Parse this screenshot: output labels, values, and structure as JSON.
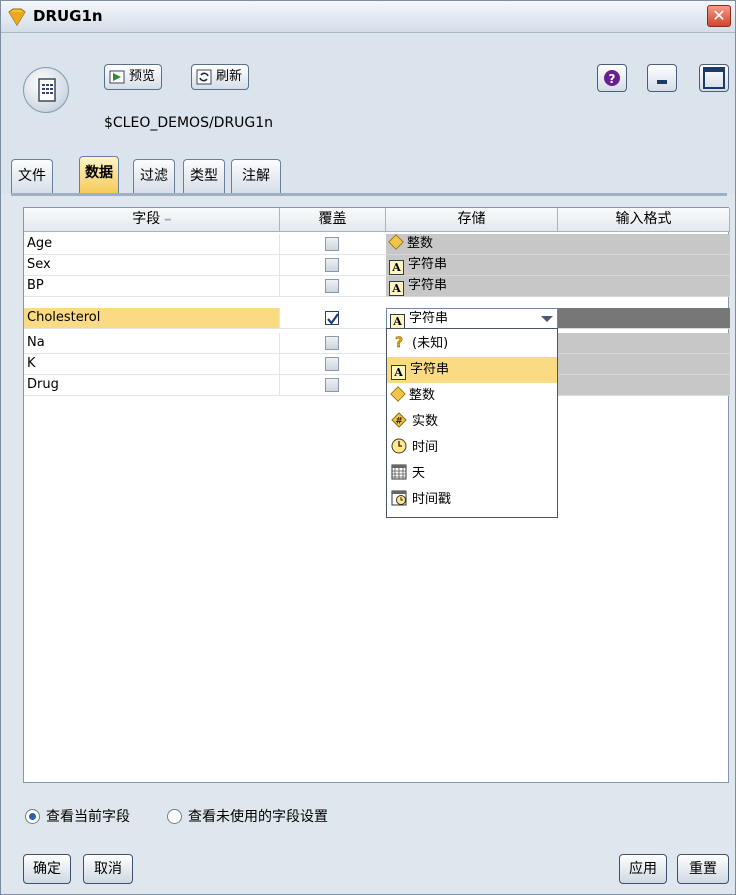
{
  "window": {
    "title": "DRUG1n",
    "close_glyph": "✕"
  },
  "toolbar": {
    "preview_label": "预览",
    "refresh_label": "刷新",
    "help_glyph": "?"
  },
  "header": {
    "path": "$CLEO_DEMOS/DRUG1n"
  },
  "tabs": [
    {
      "label": "文件"
    },
    {
      "label": "数据",
      "active": true
    },
    {
      "label": "过滤"
    },
    {
      "label": "类型"
    },
    {
      "label": "注解"
    }
  ],
  "table": {
    "columns": [
      "字段",
      "覆盖",
      "存储",
      "输入格式"
    ],
    "sort_glyph": "━",
    "rows": [
      {
        "field": "Age",
        "override": false,
        "storage": "整数",
        "storage_icon": "integer-icon"
      },
      {
        "field": "Sex",
        "override": false,
        "storage": "字符串",
        "storage_icon": "string-icon"
      },
      {
        "field": "BP",
        "override": false,
        "storage": "字符串",
        "storage_icon": "string-icon"
      },
      {
        "field": "Cholesterol",
        "override": true,
        "storage": "字符串",
        "storage_icon": "string-icon",
        "selected": true
      },
      {
        "field": "Na",
        "override": false
      },
      {
        "field": "K",
        "override": false
      },
      {
        "field": "Drug",
        "override": false
      }
    ]
  },
  "storage_dropdown": {
    "options": [
      {
        "label": "(未知)",
        "icon": "unknown-icon"
      },
      {
        "label": "字符串",
        "icon": "string-icon",
        "selected": true
      },
      {
        "label": "整数",
        "icon": "integer-icon"
      },
      {
        "label": "实数",
        "icon": "real-icon"
      },
      {
        "label": "时间",
        "icon": "clock-icon"
      },
      {
        "label": "天",
        "icon": "calendar-icon"
      },
      {
        "label": "时间戳",
        "icon": "timestamp-icon"
      }
    ]
  },
  "view_options": {
    "current": "查看当前字段",
    "unused": "查看未使用的字段设置",
    "selected": "current"
  },
  "buttons": {
    "ok": "确定",
    "cancel": "取消",
    "apply": "应用",
    "reset": "重置"
  },
  "colors": {
    "selection": "#fadb84",
    "active_tab": "#f6c955",
    "close": "#d2452c"
  }
}
